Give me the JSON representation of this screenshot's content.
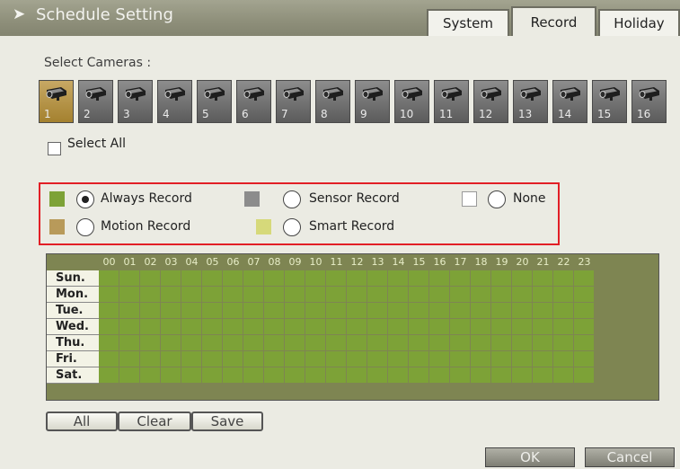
{
  "window": {
    "title": "Schedule Setting"
  },
  "tabs": [
    {
      "label": "System",
      "active": false
    },
    {
      "label": "Record",
      "active": true
    },
    {
      "label": "Holiday",
      "active": false
    }
  ],
  "cameras": {
    "label": "Select Cameras :",
    "selected": 1,
    "items": [
      "1",
      "2",
      "3",
      "4",
      "5",
      "6",
      "7",
      "8",
      "9",
      "10",
      "11",
      "12",
      "13",
      "14",
      "15",
      "16"
    ],
    "icon": "camera-icon"
  },
  "select_all": {
    "label": "Select All",
    "checked": false
  },
  "record_modes": [
    {
      "label": "Always Record",
      "color": "#7da237",
      "selected": true
    },
    {
      "label": "Sensor Record",
      "color": "#8c8c8c",
      "selected": false
    },
    {
      "label": "None",
      "color": "#ffffff",
      "selected": false
    },
    {
      "label": "Motion Record",
      "color": "#b89a5a",
      "selected": false
    },
    {
      "label": "Smart Record",
      "color": "#d6d97a",
      "selected": false
    }
  ],
  "schedule": {
    "hours": [
      "00",
      "01",
      "02",
      "03",
      "04",
      "05",
      "06",
      "07",
      "08",
      "09",
      "10",
      "11",
      "12",
      "13",
      "14",
      "15",
      "16",
      "17",
      "18",
      "19",
      "20",
      "21",
      "22",
      "23"
    ],
    "days": [
      "Sun.",
      "Mon.",
      "Tue.",
      "Wed.",
      "Thu.",
      "Fri.",
      "Sat."
    ],
    "fill_mode": "Always Record"
  },
  "actions": {
    "all": "All",
    "clear": "Clear",
    "save": "Save"
  },
  "dialog": {
    "ok": "OK",
    "cancel": "Cancel"
  },
  "colors": {
    "always": "#7da237",
    "accent_red": "#e21f26",
    "camera_selected": "#b8963f"
  }
}
